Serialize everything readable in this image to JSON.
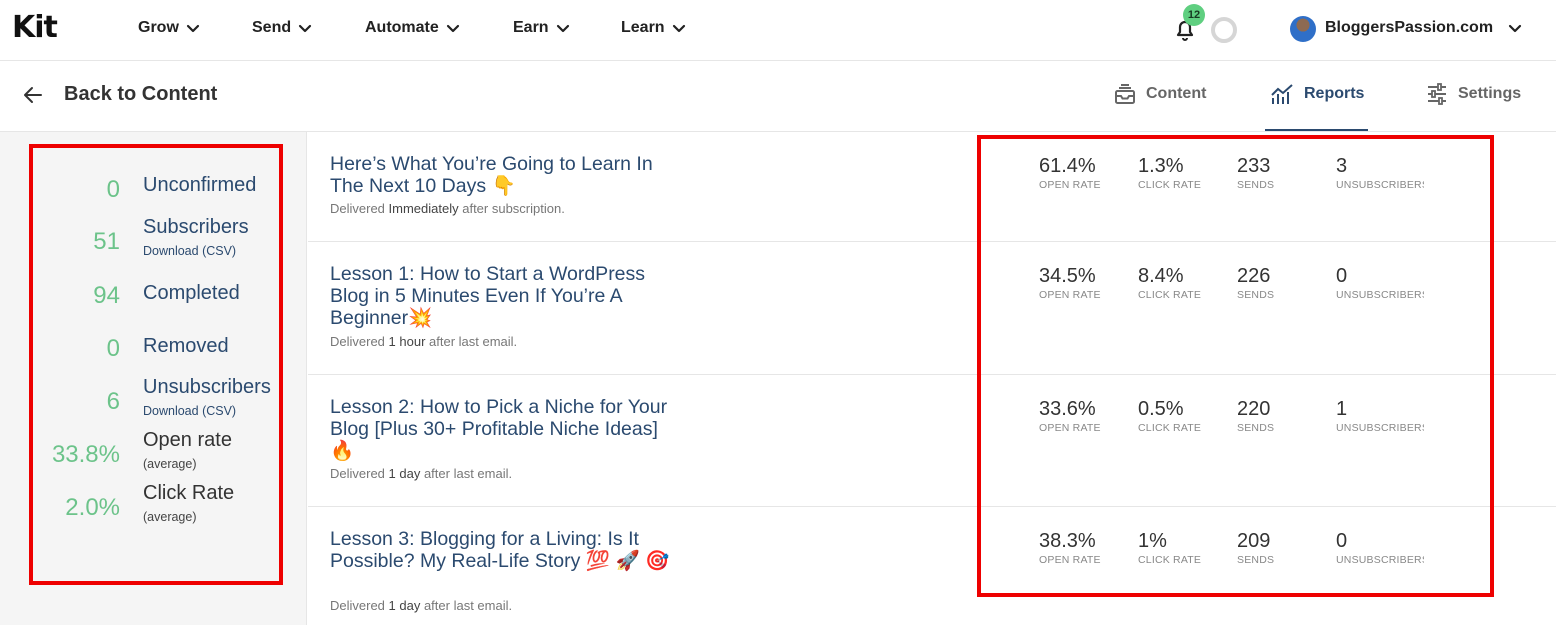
{
  "nav": {
    "logo": "Kit",
    "items": [
      {
        "label": "Grow"
      },
      {
        "label": "Send"
      },
      {
        "label": "Automate"
      },
      {
        "label": "Earn"
      },
      {
        "label": "Learn"
      }
    ],
    "notification_count": "12",
    "account_name": "BloggersPassion.com"
  },
  "subheader": {
    "back_label": "Back to Content",
    "tabs": [
      {
        "label": "Content",
        "icon": "tray-icon"
      },
      {
        "label": "Reports",
        "icon": "bar-chart-icon",
        "active": true
      },
      {
        "label": "Settings",
        "icon": "sliders-icon"
      }
    ]
  },
  "stats": [
    {
      "value": "0",
      "label": "Unconfirmed"
    },
    {
      "value": "51",
      "label": "Subscribers",
      "sub": "Download (CSV)"
    },
    {
      "value": "94",
      "label": "Completed"
    },
    {
      "value": "0",
      "label": "Removed"
    },
    {
      "value": "6",
      "label": "Unsubscribers",
      "sub": "Download (CSV)"
    },
    {
      "value": "33.8%",
      "label": "Open rate",
      "sub": "(average)"
    },
    {
      "value": "2.0%",
      "label": "Click Rate",
      "sub": "(average)"
    }
  ],
  "metric_labels": {
    "open_rate": "OPEN RATE",
    "click_rate": "CLICK RATE",
    "sends": "SENDS",
    "unsubscribers": "UNSUBSCRIBERS"
  },
  "emails": [
    {
      "title": "Here’s What You’re Going to Learn In The Next 10 Days 👇",
      "meta_prefix": "Delivered ",
      "meta_bold": "Immediately",
      "meta_suffix": " after subscription.",
      "open_rate": "61.4%",
      "click_rate": "1.3%",
      "sends": "233",
      "unsubscribers": "3"
    },
    {
      "title": "Lesson 1: How to Start a WordPress Blog in 5 Minutes Even If You’re A Beginner💥",
      "meta_prefix": "Delivered ",
      "meta_bold": "1 hour",
      "meta_suffix": " after last email.",
      "open_rate": "34.5%",
      "click_rate": "8.4%",
      "sends": "226",
      "unsubscribers": "0"
    },
    {
      "title": "Lesson 2: How to Pick a Niche for Your Blog [Plus 30+ Profitable Niche Ideas] 🔥",
      "meta_prefix": "Delivered ",
      "meta_bold": "1 day",
      "meta_suffix": " after last email.",
      "open_rate": "33.6%",
      "click_rate": "0.5%",
      "sends": "220",
      "unsubscribers": "1"
    },
    {
      "title": "Lesson 3: Blogging for a Living: Is It Possible? My Real-Life Story 💯 🚀 🎯",
      "meta_prefix": "Delivered ",
      "meta_bold": "1 day",
      "meta_suffix": " after last email.",
      "open_rate": "38.3%",
      "click_rate": "1%",
      "sends": "209",
      "unsubscribers": "0"
    }
  ],
  "colors": {
    "accent": "#2b4a6f",
    "stat_value": "#6cc38a",
    "highlight": "#ee0000",
    "badge": "#5fcf80"
  }
}
